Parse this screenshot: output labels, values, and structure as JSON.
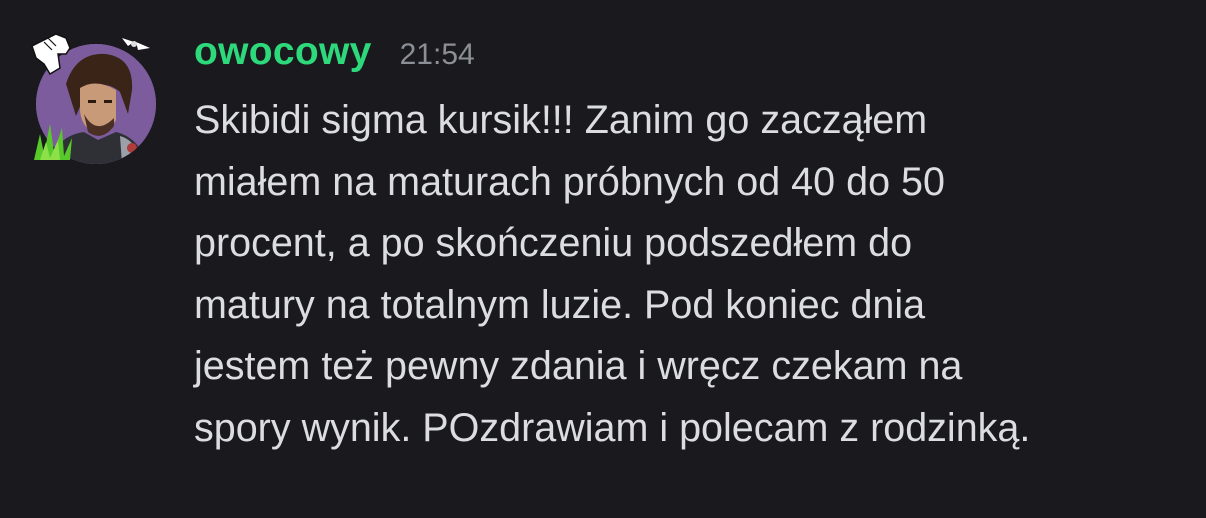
{
  "message": {
    "author": "owocowy",
    "timestamp": "21:54",
    "text": "Skibidi sigma kursik!!! Zanim go zacząłem\nmiałem na maturach próbnych od 40 do 50\nprocent, a po skończeniu podszedłem do\nmatury na totalnym luzie. Pod koniec dnia\njestem też pewny zdania i wręcz czekam na\nspory wynik. POzdrawiam i polecam z rodzinką."
  },
  "colors": {
    "background": "#1a1a1e",
    "author": "#2dd97b",
    "timestamp": "#8c8f96",
    "text": "#dcdde1",
    "avatar_bg": "#7a5a9c"
  }
}
